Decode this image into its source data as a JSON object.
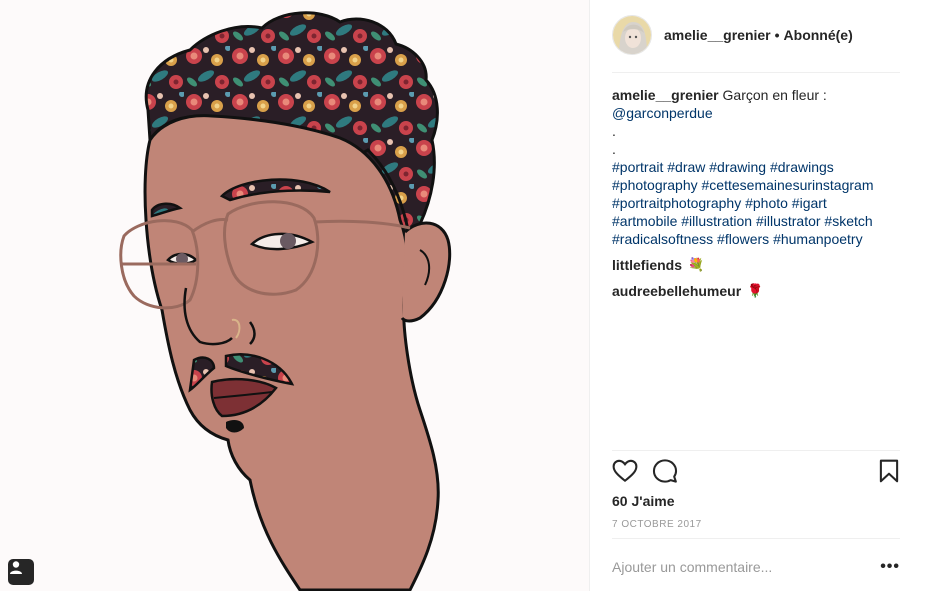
{
  "post": {
    "author": {
      "username": "amelie__grenier",
      "separator": "•",
      "follow_status": "Abonné(e)"
    },
    "caption": {
      "username": "amelie__grenier",
      "text": "Garçon en fleur :",
      "mention": "@garconperdue",
      "dot_line_1": ".",
      "dot_line_2": ".",
      "hashtags_lines": [
        "#portrait #draw #drawing #drawings",
        "#photography #cettesemainesurinstagram",
        "#portraitphotography #photo #igart",
        "#artmobile #illustration #illustrator #sketch",
        "#radicalsoftness #flowers #humanpoetry"
      ]
    },
    "comments": [
      {
        "username": "littlefiends",
        "emoji": "💐"
      },
      {
        "username": "audreebellehumeur",
        "emoji": "🌹"
      }
    ],
    "likes": "60 J'aime",
    "date": "7 OCTOBRE 2017",
    "add_comment_placeholder": "Ajouter un commentaire...",
    "more_label": "•••",
    "icons": {
      "like": "heart-icon",
      "comment": "comment-bubble-icon",
      "save": "bookmark-icon",
      "tagged_user": "user-tag-icon"
    },
    "colors": {
      "skin": "#c08577",
      "hair_dark": "#2a1e26",
      "flower_red": "#c9434c",
      "flower_teal": "#2f7a7f",
      "flower_gold": "#d9a04a",
      "lips": "#7d3034",
      "glasses": "#9a6a5e",
      "link": "#003569"
    }
  }
}
